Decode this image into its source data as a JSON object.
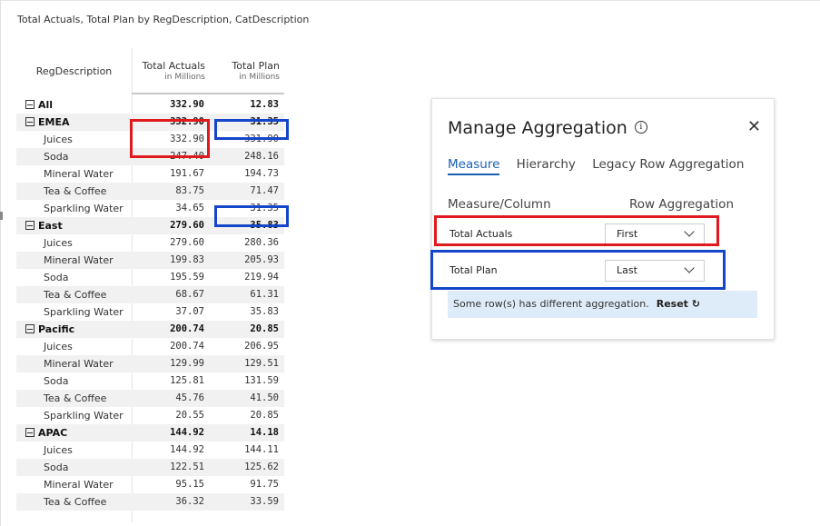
{
  "visual_title": "Total Actuals, Total Plan by RegDescription, CatDescription",
  "matrix": {
    "col_desc": "RegDescription",
    "col1": {
      "title": "Total Actuals",
      "sub": "in Millions"
    },
    "col2": {
      "title": "Total Plan",
      "sub": "in Millions"
    },
    "rows": [
      {
        "label": "All",
        "group": true,
        "actuals": "332.90",
        "plan": "12.83"
      },
      {
        "label": "EMEA",
        "group": true,
        "actuals": "332.90",
        "plan": "31.35"
      },
      {
        "label": "Juices",
        "group": false,
        "actuals": "332.90",
        "plan": "331.90"
      },
      {
        "label": "Soda",
        "group": false,
        "actuals": "247.40",
        "plan": "248.16"
      },
      {
        "label": "Mineral Water",
        "group": false,
        "actuals": "191.67",
        "plan": "194.73"
      },
      {
        "label": "Tea & Coffee",
        "group": false,
        "actuals": "83.75",
        "plan": "71.47"
      },
      {
        "label": "Sparkling Water",
        "group": false,
        "actuals": "34.65",
        "plan": "31.35"
      },
      {
        "label": "East",
        "group": true,
        "actuals": "279.60",
        "plan": "35.83"
      },
      {
        "label": "Juices",
        "group": false,
        "actuals": "279.60",
        "plan": "280.36"
      },
      {
        "label": "Mineral Water",
        "group": false,
        "actuals": "199.83",
        "plan": "205.93"
      },
      {
        "label": "Soda",
        "group": false,
        "actuals": "195.59",
        "plan": "219.94"
      },
      {
        "label": "Tea & Coffee",
        "group": false,
        "actuals": "68.67",
        "plan": "61.31"
      },
      {
        "label": "Sparkling Water",
        "group": false,
        "actuals": "37.07",
        "plan": "35.83"
      },
      {
        "label": "Pacific",
        "group": true,
        "actuals": "200.74",
        "plan": "20.85"
      },
      {
        "label": "Juices",
        "group": false,
        "actuals": "200.74",
        "plan": "206.95"
      },
      {
        "label": "Mineral Water",
        "group": false,
        "actuals": "129.99",
        "plan": "129.51"
      },
      {
        "label": "Soda",
        "group": false,
        "actuals": "125.81",
        "plan": "131.59"
      },
      {
        "label": "Tea & Coffee",
        "group": false,
        "actuals": "45.76",
        "plan": "41.50"
      },
      {
        "label": "Sparkling Water",
        "group": false,
        "actuals": "20.55",
        "plan": "20.85"
      },
      {
        "label": "APAC",
        "group": true,
        "actuals": "144.92",
        "plan": "14.18"
      },
      {
        "label": "Juices",
        "group": false,
        "actuals": "144.92",
        "plan": "144.11"
      },
      {
        "label": "Soda",
        "group": false,
        "actuals": "122.51",
        "plan": "125.62"
      },
      {
        "label": "Mineral Water",
        "group": false,
        "actuals": "95.15",
        "plan": "91.75"
      },
      {
        "label": "Tea & Coffee",
        "group": false,
        "actuals": "36.32",
        "plan": "33.59"
      }
    ]
  },
  "panel": {
    "title": "Manage Aggregation",
    "info_glyph": "i",
    "close_glyph": "✕",
    "tabs": [
      "Measure",
      "Hierarchy",
      "Legacy Row Aggregation"
    ],
    "active_tab": "Measure",
    "col_measure": "Measure/Column",
    "col_agg": "Row Aggregation",
    "measures": [
      {
        "name": "Total Actuals",
        "aggregation": "First"
      },
      {
        "name": "Total Plan",
        "aggregation": "Last"
      }
    ],
    "message": "Some row(s) has different aggregation.",
    "reset_label": "Reset",
    "reset_glyph": "↻"
  },
  "colors": {
    "highlight_red": "#e0191f",
    "highlight_blue": "#1546c9",
    "accent": "#1a5fb4",
    "message_bg": "#deecf9"
  }
}
